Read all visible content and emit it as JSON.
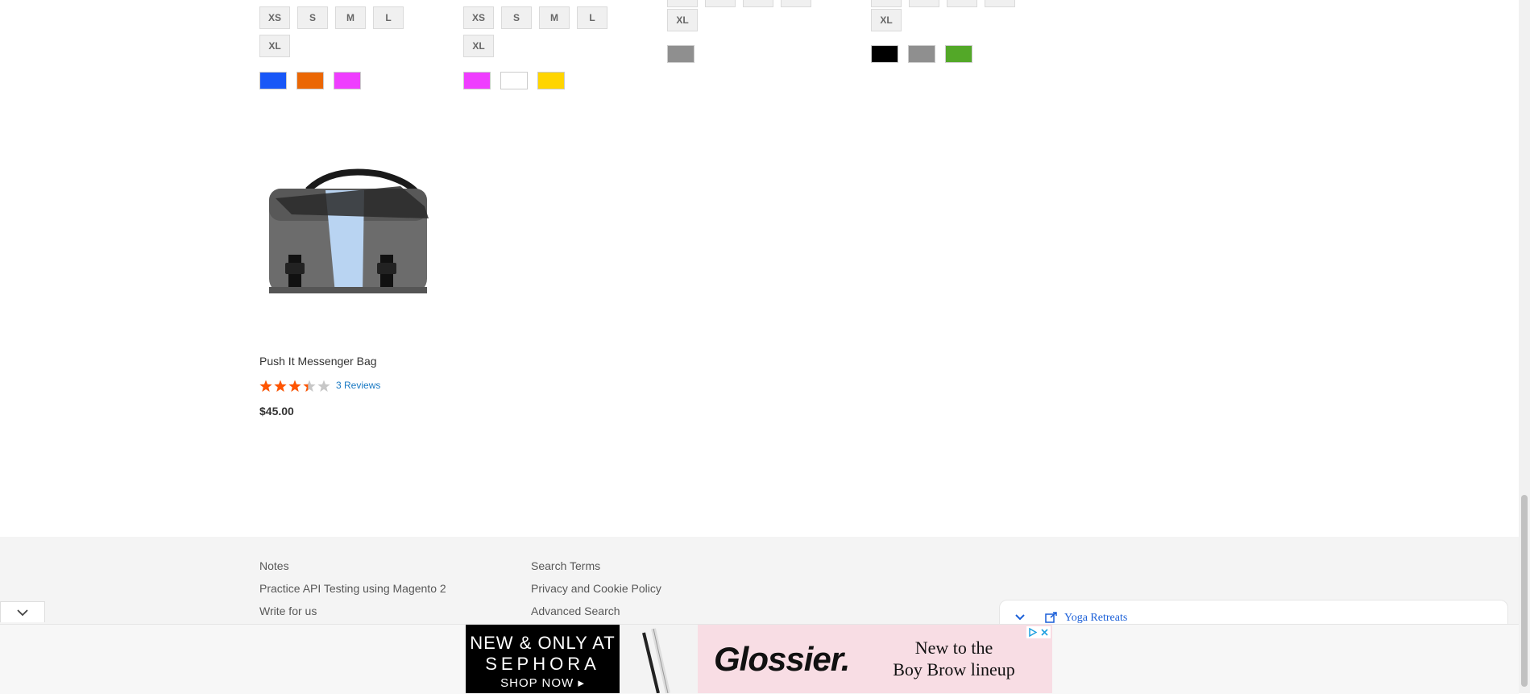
{
  "colors": {
    "swatch_blue": "#1857f7",
    "swatch_orange": "#eb6703",
    "swatch_magenta": "#ef3dff",
    "swatch_white": "#ffffff",
    "swatch_yellow": "#ffd500",
    "swatch_gray": "#8f8f8f",
    "swatch_black": "#000000",
    "swatch_green": "#53a828",
    "star_filled": "#ff5501",
    "star_empty": "#c7c7c7",
    "link": "#1979c3"
  },
  "products_above": [
    {
      "sizes": [
        "XS",
        "S",
        "M",
        "L",
        "XL"
      ],
      "colors": [
        "blue",
        "orange",
        "magenta"
      ]
    },
    {
      "sizes": [
        "XS",
        "S",
        "M",
        "L",
        "XL"
      ],
      "colors": [
        "magenta",
        "white",
        "yellow"
      ]
    },
    {
      "sizes": [
        "XL"
      ],
      "colors": [
        "gray"
      ]
    },
    {
      "sizes": [
        "XL"
      ],
      "colors": [
        "black",
        "gray",
        "green"
      ]
    }
  ],
  "product": {
    "name": "Push It Messenger Bag",
    "rating_percent": 67,
    "reviews": "3 Reviews",
    "price": "$45.00"
  },
  "footer": {
    "col1": [
      "Notes",
      "Practice API Testing using Magento 2",
      "Write for us"
    ],
    "col2": [
      "Search Terms",
      "Privacy and Cookie Policy",
      "Advanced Search"
    ]
  },
  "widget": {
    "text": "Yoga Retreats"
  },
  "ad": {
    "line1": "NEW & ONLY AT",
    "line2": "SEPHORA",
    "cta": "SHOP NOW ▸",
    "brand": "Glossier.",
    "tagline1": "New to the",
    "tagline2": "Boy Brow lineup"
  }
}
